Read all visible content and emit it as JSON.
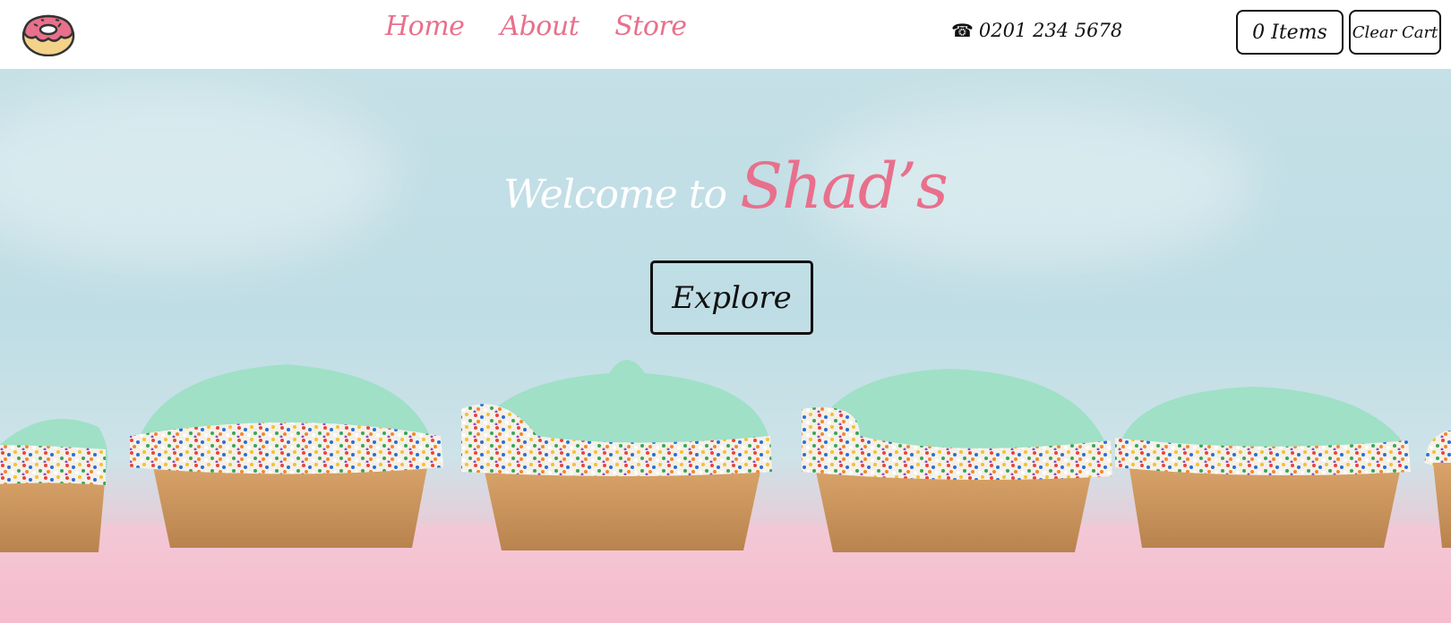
{
  "nav": {
    "links": [
      "Home",
      "About",
      "Store"
    ],
    "phone": "0201 234 5678",
    "phone_icon": "phone-icon",
    "cart_items": "0 Items",
    "clear_cart": "Clear Cart",
    "logo_icon": "donut-icon"
  },
  "hero": {
    "welcome": "Welcome to",
    "brand": "Shad’s",
    "explore": "Explore"
  },
  "colors": {
    "accent": "#e8708c",
    "frosting": "#9fe0c7",
    "sky": "#c5e0e6",
    "table": "#f3c8d6"
  }
}
